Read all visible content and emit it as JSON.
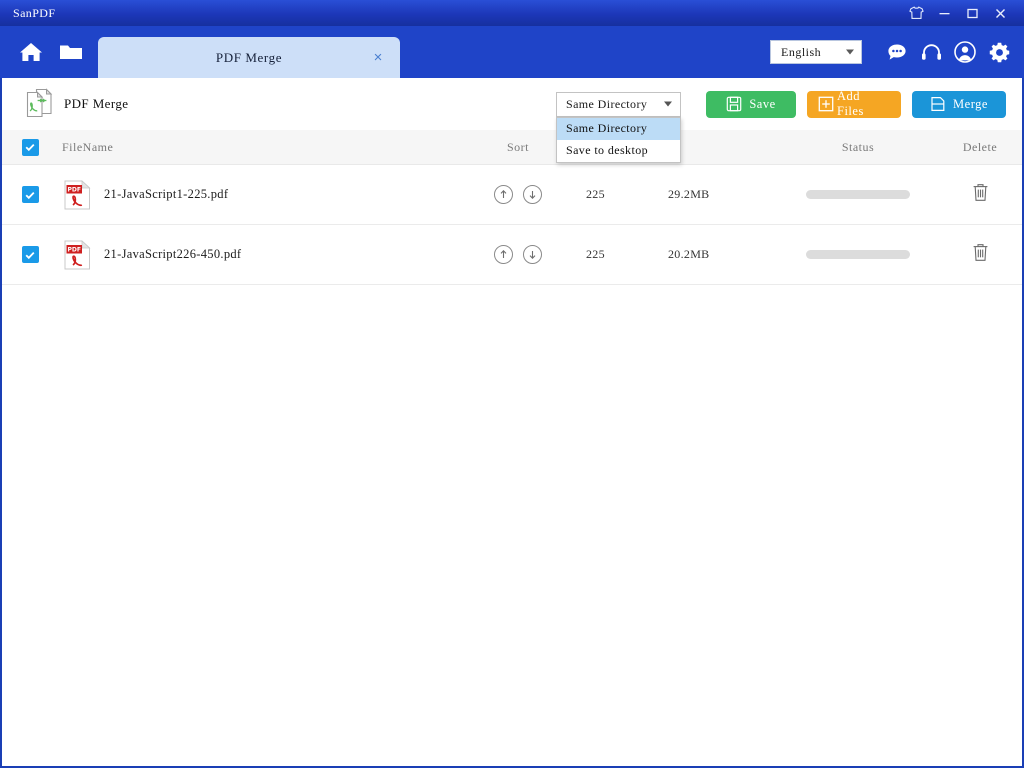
{
  "window": {
    "app_title": "SanPDF",
    "controls": [
      {
        "name": "skin-icon",
        "label": "Skin"
      },
      {
        "name": "minimize-button",
        "label": "Minimize"
      },
      {
        "name": "maximize-button",
        "label": "Maximize"
      },
      {
        "name": "close-button",
        "label": "Close"
      }
    ]
  },
  "navbar": {
    "home_icon": "home-icon",
    "folder_icon": "folder-icon",
    "tab": {
      "label": "PDF Merge",
      "close": "×"
    },
    "language": {
      "value": "English",
      "options": [
        "English"
      ]
    },
    "icons": [
      {
        "name": "chat-icon",
        "label": "Feedback"
      },
      {
        "name": "headset-icon",
        "label": "Support"
      },
      {
        "name": "user-account-icon",
        "label": "Account"
      },
      {
        "name": "gear-icon",
        "label": "Settings"
      }
    ]
  },
  "toolbar": {
    "title": "PDF Merge",
    "title_icon": "pdf-merge-icon",
    "output_dropdown": {
      "value": "Same Directory",
      "open": true,
      "options": [
        {
          "label": "Same Directory",
          "selected": true
        },
        {
          "label": "Save to desktop",
          "selected": false
        }
      ]
    },
    "save_label": "Save",
    "add_files_label": "Add Files",
    "merge_label": "Merge",
    "colors": {
      "save": "#3ebc63",
      "add_files": "#f5a623",
      "merge": "#1b95d8",
      "titlebar": "#1c37b8",
      "navbar": "#1f44c8",
      "tab": "#cddff8",
      "checkbox": "#1a9ae8",
      "progress_bar": "#dcdcdc"
    }
  },
  "table": {
    "headers": {
      "select_all": "",
      "filename": "FileName",
      "sort": "Sort",
      "pages": "",
      "size": "",
      "status": "Status",
      "delete": "Delete"
    },
    "select_all_checked": true,
    "rows": [
      {
        "checked": true,
        "icon": "pdf-file-icon",
        "filename": "21-JavaScript1-225.pdf",
        "pages": "225",
        "size": "29.2MB",
        "status_progress": 0,
        "delete_icon": "trash-icon"
      },
      {
        "checked": true,
        "icon": "pdf-file-icon",
        "filename": "21-JavaScript226-450.pdf",
        "pages": "225",
        "size": "20.2MB",
        "status_progress": 0,
        "delete_icon": "trash-icon"
      }
    ]
  }
}
